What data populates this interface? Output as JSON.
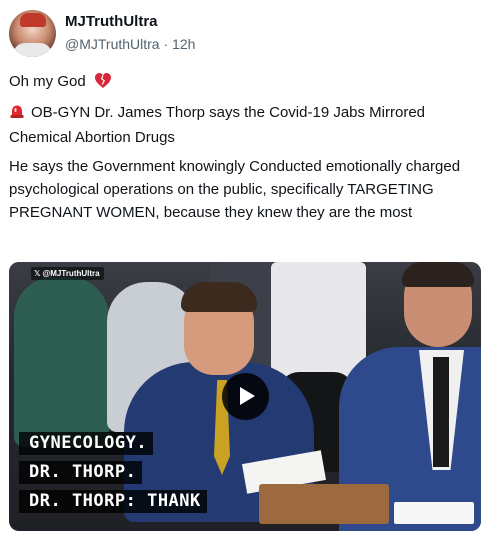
{
  "post": {
    "display_name": "MJTruthUltra",
    "handle": "@MJTruthUltra",
    "separator": "·",
    "time": "12h",
    "line1": "Oh my God",
    "line2": "OB-GYN Dr. James Thorp says the Covid-19 Jabs Mirrored Chemical Abortion Drugs",
    "line3": "He says the Government knowingly Conducted emotionally charged psychological operations on the public, specifically TARGETING PREGNANT WOMEN, because they knew they are the most"
  },
  "media": {
    "watermark": "@MJTruthUltra",
    "captions": [
      "GYNECOLOGY.",
      "DR. THORP.",
      "DR. THORP: THANK"
    ]
  },
  "icons": {
    "heart": "broken-heart-icon",
    "siren": "siren-icon",
    "play": "play-icon",
    "x_logo": "x-logo-icon"
  },
  "colors": {
    "heart": "#d8263a",
    "siren": "#e0272f",
    "secondary_text": "#536471"
  }
}
